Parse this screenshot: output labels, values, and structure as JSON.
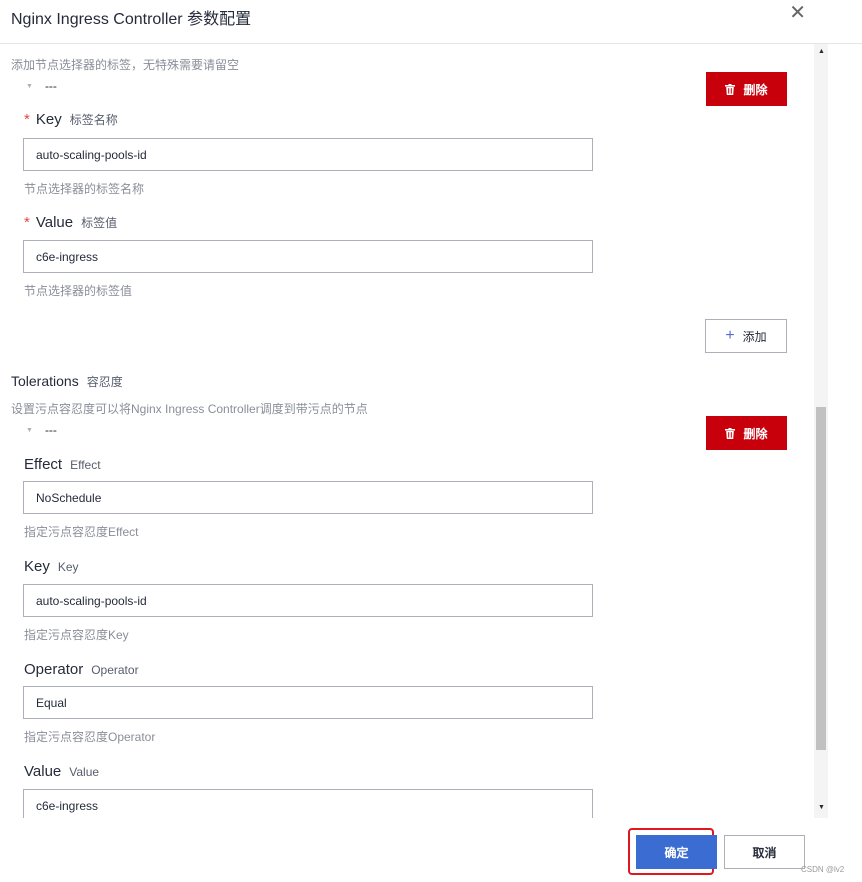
{
  "dialog": {
    "title": "Nginx Ingress Controller 参数配置",
    "close_icon": "✕"
  },
  "node_selector": {
    "hint": "添加节点选择器的标签，无特殊需要请留空",
    "item_marker": "---",
    "delete_label": "删除",
    "key": {
      "label": "Key",
      "sublabel": "标签名称",
      "value": "auto-scaling-pools-id",
      "help": "节点选择器的标签名称"
    },
    "value": {
      "label": "Value",
      "sublabel": "标签值",
      "value": "c6e-ingress",
      "help": "节点选择器的标签值"
    },
    "add_label": "添加"
  },
  "tolerations": {
    "title": "Tolerations",
    "title_sub": "容忍度",
    "hint": "设置污点容忍度可以将Nginx Ingress Controller调度到带污点的节点",
    "item_marker": "---",
    "delete_label": "删除",
    "effect": {
      "label": "Effect",
      "sublabel": "Effect",
      "value": "NoSchedule",
      "help": "指定污点容忍度Effect"
    },
    "key": {
      "label": "Key",
      "sublabel": "Key",
      "value": "auto-scaling-pools-id",
      "help": "指定污点容忍度Key"
    },
    "operator": {
      "label": "Operator",
      "sublabel": "Operator",
      "value": "Equal",
      "help": "指定污点容忍度Operator"
    },
    "value": {
      "label": "Value",
      "sublabel": "Value",
      "value": "c6e-ingress"
    }
  },
  "footer": {
    "confirm_label": "确定",
    "cancel_label": "取消",
    "watermark": "CSDN @lv2"
  },
  "icons": {
    "close": "close-icon",
    "trash": "trash-icon",
    "plus": "plus-icon",
    "caret": "caret-down-icon"
  },
  "colors": {
    "danger": "#c7000b",
    "primary": "#3b6cd2",
    "highlight": "#e0181e",
    "required": "#e54545"
  }
}
